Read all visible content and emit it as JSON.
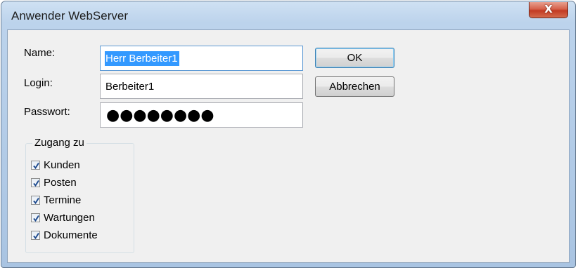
{
  "window": {
    "title": "Anwender WebServer",
    "close_glyph": "X"
  },
  "form": {
    "name_label": "Name:",
    "name_value": "Herr Berbeiter1",
    "login_label": "Login:",
    "login_value": "Berbeiter1",
    "password_label": "Passwort:",
    "password_mask": "●●●●●●●●"
  },
  "buttons": {
    "ok": "OK",
    "cancel": "Abbrechen"
  },
  "access": {
    "legend": "Zugang zu",
    "items": [
      {
        "label": "Kunden",
        "checked": true
      },
      {
        "label": "Posten",
        "checked": true
      },
      {
        "label": "Termine",
        "checked": true
      },
      {
        "label": "Wartungen",
        "checked": true
      },
      {
        "label": "Dokumente",
        "checked": true
      }
    ]
  },
  "colors": {
    "selection": "#3399ff",
    "close_button": "#c23a22",
    "check": "#1e4b8f"
  }
}
